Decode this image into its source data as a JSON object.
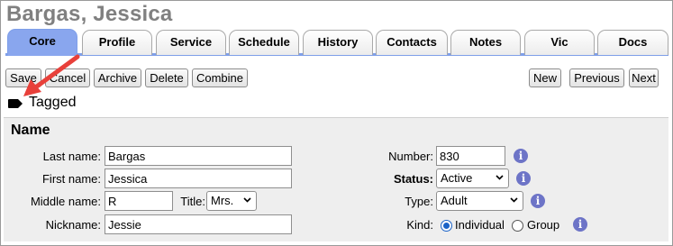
{
  "record": {
    "title": "Bargas, Jessica"
  },
  "tabs": [
    {
      "label": "Core"
    },
    {
      "label": "Profile"
    },
    {
      "label": "Service"
    },
    {
      "label": "Schedule"
    },
    {
      "label": "History"
    },
    {
      "label": "Contacts"
    },
    {
      "label": "Notes"
    },
    {
      "label": "Vic"
    },
    {
      "label": "Docs"
    }
  ],
  "active_tab": "Core",
  "toolbar": {
    "save": "Save",
    "cancel": "Cancel",
    "archive": "Archive",
    "delete": "Delete",
    "combine": "Combine",
    "new": "New",
    "previous": "Previous",
    "next": "Next"
  },
  "tag": {
    "label": "Tagged",
    "icon": "tag-icon"
  },
  "annotation": {
    "arrow_color": "#e8403a"
  },
  "name_section": {
    "title": "Name",
    "last_name_label": "Last name:",
    "last_name_value": "Bargas",
    "first_name_label": "First name:",
    "first_name_value": "Jessica",
    "middle_name_label": "Middle name:",
    "middle_name_value": "R",
    "title_label": "Title:",
    "title_value": "Mrs.",
    "nickname_label": "Nickname:",
    "nickname_value": "Jessie",
    "number_label": "Number:",
    "number_value": "830",
    "status_label": "Status:",
    "status_value": "Active",
    "type_label": "Type:",
    "type_value": "Adult",
    "kind_label": "Kind:",
    "kind_options": [
      "Individual",
      "Group"
    ],
    "kind_selected": "Individual"
  },
  "colors": {
    "tab_active": "#89a6ee",
    "info_icon": "#6d74c7",
    "radio_selected": "#1a62c7"
  }
}
